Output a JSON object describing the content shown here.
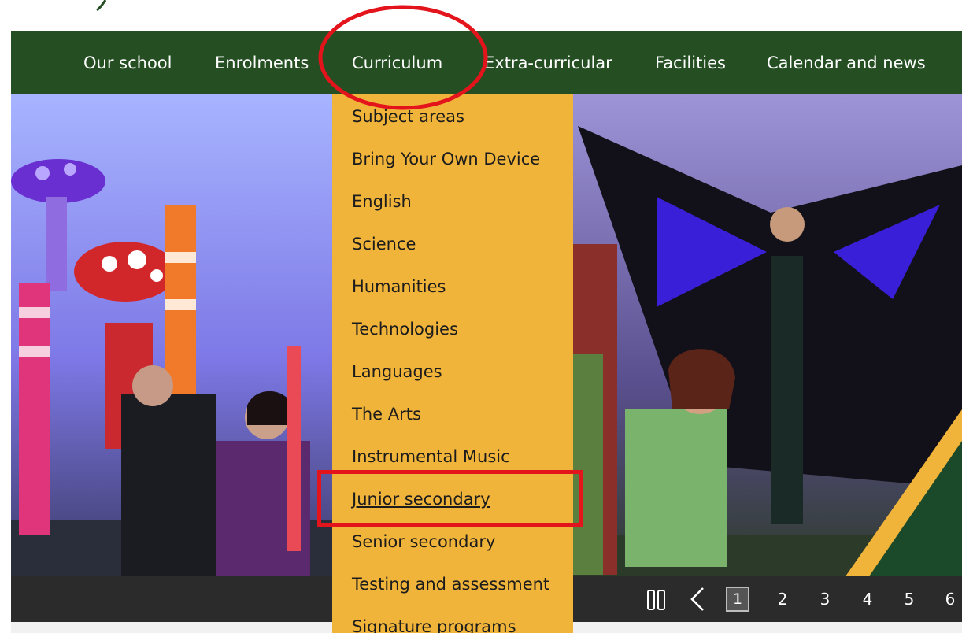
{
  "nav": {
    "items": [
      {
        "label": "Our school"
      },
      {
        "label": "Enrolments"
      },
      {
        "label": "Curriculum"
      },
      {
        "label": "Extra-curricular"
      },
      {
        "label": "Facilities"
      },
      {
        "label": "Calendar and news"
      }
    ],
    "active": "Curriculum"
  },
  "dropdown": {
    "items": [
      {
        "label": "Subject areas"
      },
      {
        "label": "Bring Your Own Device"
      },
      {
        "label": "English"
      },
      {
        "label": "Science"
      },
      {
        "label": "Humanities"
      },
      {
        "label": "Technologies"
      },
      {
        "label": "Languages"
      },
      {
        "label": "The Arts"
      },
      {
        "label": "Instrumental Music"
      },
      {
        "label": "Junior secondary"
      },
      {
        "label": "Senior secondary"
      },
      {
        "label": "Testing and assessment"
      },
      {
        "label": "Signature programs"
      }
    ],
    "hovered": "Junior secondary"
  },
  "carousel": {
    "pages": [
      "1",
      "2",
      "3",
      "4",
      "5",
      "6"
    ],
    "current": "1",
    "icons": [
      "pause-icon",
      "chevron-left-icon"
    ]
  },
  "colors": {
    "nav_bg": "#254f23",
    "dropdown_bg": "#f1b43a",
    "carousel_bar": "#2b2b2b",
    "annotation": "#e3141b"
  }
}
